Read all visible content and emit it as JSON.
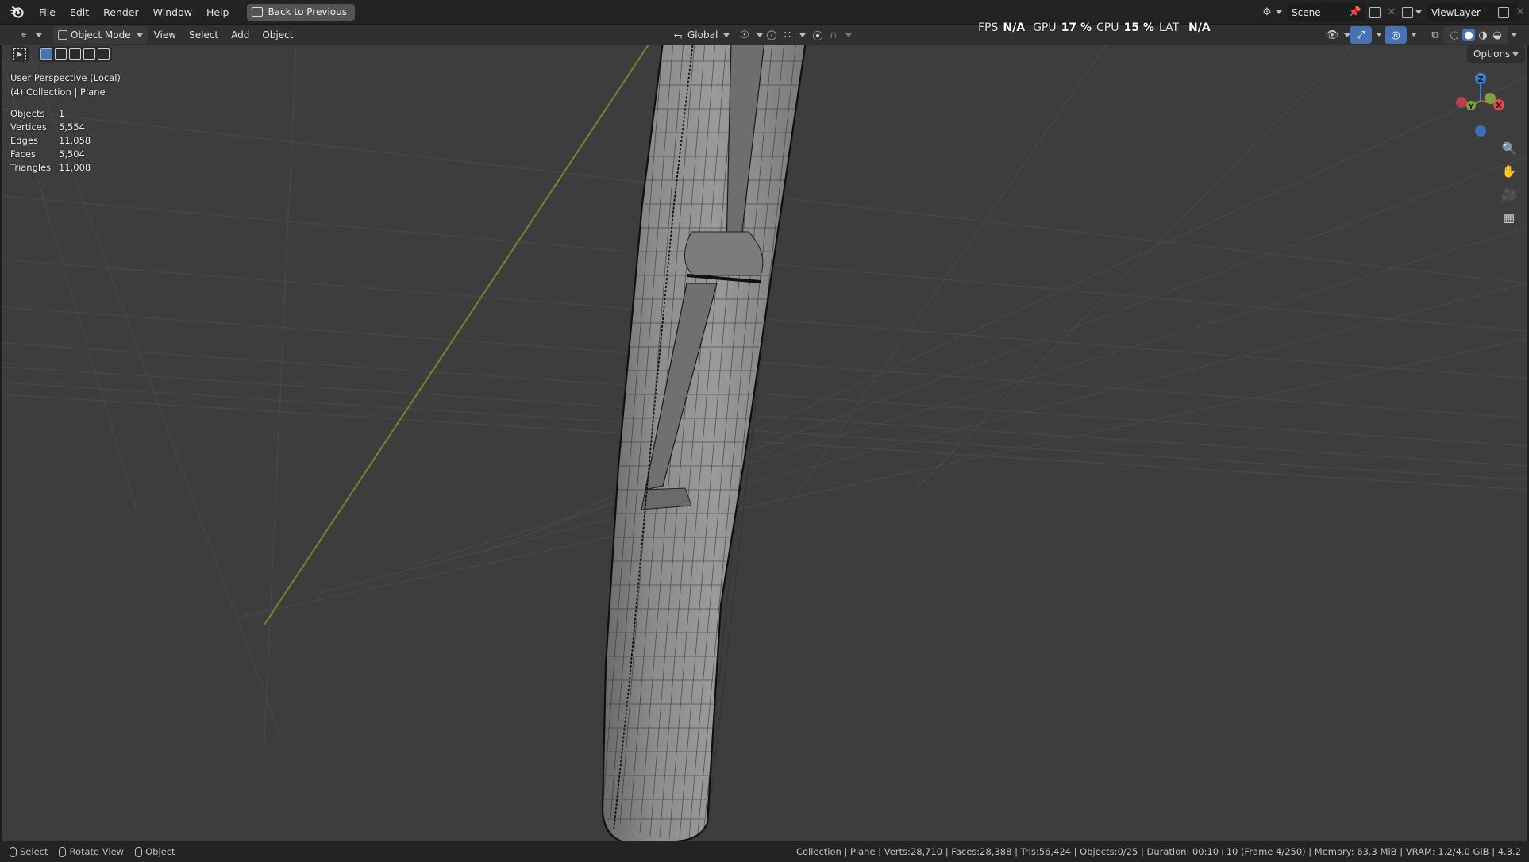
{
  "app": {
    "name": "Blender"
  },
  "topbar": {
    "menus": [
      "File",
      "Edit",
      "Render",
      "Window",
      "Help"
    ],
    "back_button": "Back to Previous",
    "scene_field": "Scene",
    "view_layer_field": "ViewLayer"
  },
  "header": {
    "mode": "Object Mode",
    "menus": [
      "View",
      "Select",
      "Add",
      "Object"
    ],
    "transform_orientation": "Global",
    "options_label": "Options"
  },
  "performance": {
    "fps_label": "FPS",
    "fps_value": "N/A",
    "gpu_label": "GPU",
    "gpu_value": "17 %",
    "cpu_label": "CPU",
    "cpu_value": "15 %",
    "lat_label": "LAT",
    "lat_value": "N/A"
  },
  "viewport": {
    "view_name": "User Perspective (Local)",
    "collection_line": "(4) Collection | Plane",
    "stats": [
      {
        "key": "Objects",
        "value": "1"
      },
      {
        "key": "Vertices",
        "value": "5,554"
      },
      {
        "key": "Edges",
        "value": "11,058"
      },
      {
        "key": "Faces",
        "value": "5,504"
      },
      {
        "key": "Triangles",
        "value": "11,008"
      }
    ],
    "gizmo_axes": {
      "x": "X",
      "y": "Y",
      "z": "Z"
    },
    "colors": {
      "background": "#3d3d3d",
      "x_axis": "#e0474f",
      "y_axis": "#7ea23a",
      "z_axis": "#3f7fd6",
      "mesh": "#8a8a8a",
      "wire": "#141414"
    }
  },
  "statusbar": {
    "hints": [
      {
        "icon": "mouse-left-icon",
        "label": "Select"
      },
      {
        "icon": "mouse-middle-icon",
        "label": "Rotate View"
      },
      {
        "icon": "mouse-right-icon",
        "label": "Object"
      }
    ],
    "info": "Collection | Plane | Verts:28,710 | Faces:28,388 | Tris:56,424 | Objects:0/25 | Duration: 00:10+10 (Frame 4/250) | Memory: 63.3 MiB | VRAM: 1.2/4.0 GiB | 4.3.2"
  }
}
